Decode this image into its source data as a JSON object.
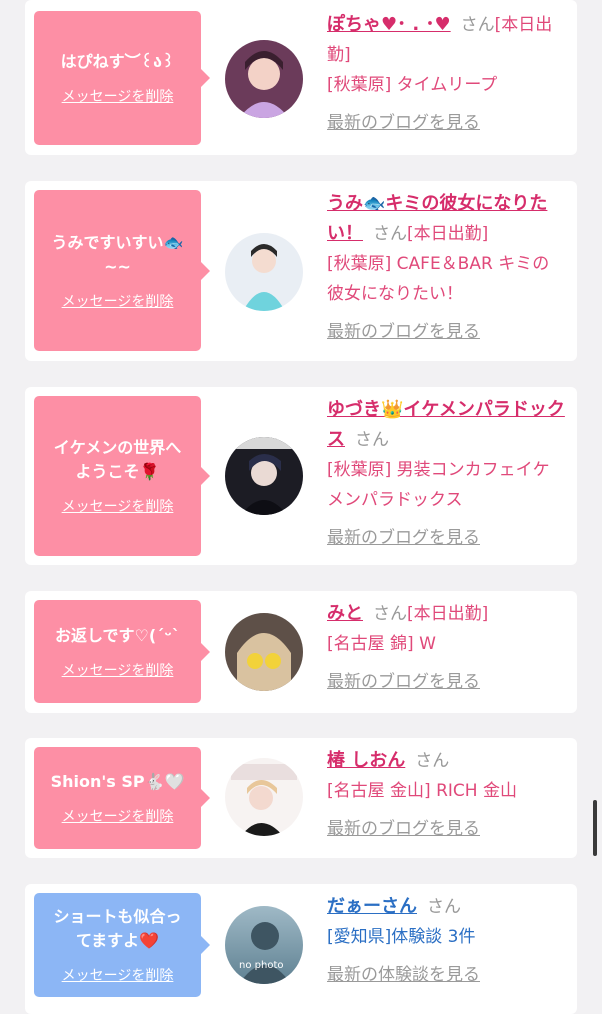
{
  "messages": [
    {
      "bubble_text": "はぴねす︶꒰ა꒱",
      "delete_label": "メッセージを削除",
      "name": "ぽちゃ♥︎･ . ･︎♥",
      "san": "さん",
      "status": "[本日出勤]",
      "location": "[秋葉原] タイムリープ",
      "link_label": "最新のブログを見る",
      "theme": "pink",
      "avatar": "person-photo-icon"
    },
    {
      "bubble_text": "うみですいすい🐟\n~~",
      "delete_label": "メッセージを削除",
      "name": "うみ🐟キミの彼女になりたい！",
      "san": "さん",
      "status": "[本日出勤]",
      "location": "[秋葉原] CAFE＆BAR キミの彼女になりたい！",
      "link_label": "最新のブログを見る",
      "theme": "pink",
      "avatar": "person-photo-icon"
    },
    {
      "bubble_text": "イケメンの世界へ\nようこそ🌹",
      "delete_label": "メッセージを削除",
      "name": "ゆづき👑イケメンパラドックス",
      "san": "さん",
      "status": "",
      "location": "[秋葉原] 男装コンカフェイケメンパラドックス",
      "link_label": "最新のブログを見る",
      "theme": "pink",
      "avatar": "person-photo-icon"
    },
    {
      "bubble_text": "お返しです♡(ˊᵕˋ",
      "delete_label": "メッセージを削除",
      "name": "みと",
      "san": "さん",
      "status": "[本日出勤]",
      "location": "[名古屋 錦] W",
      "link_label": "最新のブログを見る",
      "theme": "pink",
      "avatar": "person-photo-icon"
    },
    {
      "bubble_text": "Shion's SP🐇🤍",
      "delete_label": "メッセージを削除",
      "name": "椿 しおん",
      "san": "さん",
      "status": "",
      "location": "[名古屋 金山] RICH 金山",
      "link_label": "最新のブログを見る",
      "theme": "pink",
      "avatar": "person-photo-icon"
    },
    {
      "bubble_text": "ショートも似合っ\nてますよ❤️",
      "delete_label": "メッセージを削除",
      "name": "だぁーさん",
      "san": "さん",
      "status": "",
      "location": "[愛知県]体験談 3件",
      "link_label": "最新の体験談を見る",
      "theme": "blue",
      "avatar": "no-photo-icon",
      "avatar_text": "no photo"
    }
  ],
  "colors": {
    "pink_bubble": "#fd8fa5",
    "blue_bubble": "#8cb6f5",
    "name_pink": "#d62d6b",
    "name_blue": "#2b6fc4",
    "background": "#f2f1f3"
  }
}
